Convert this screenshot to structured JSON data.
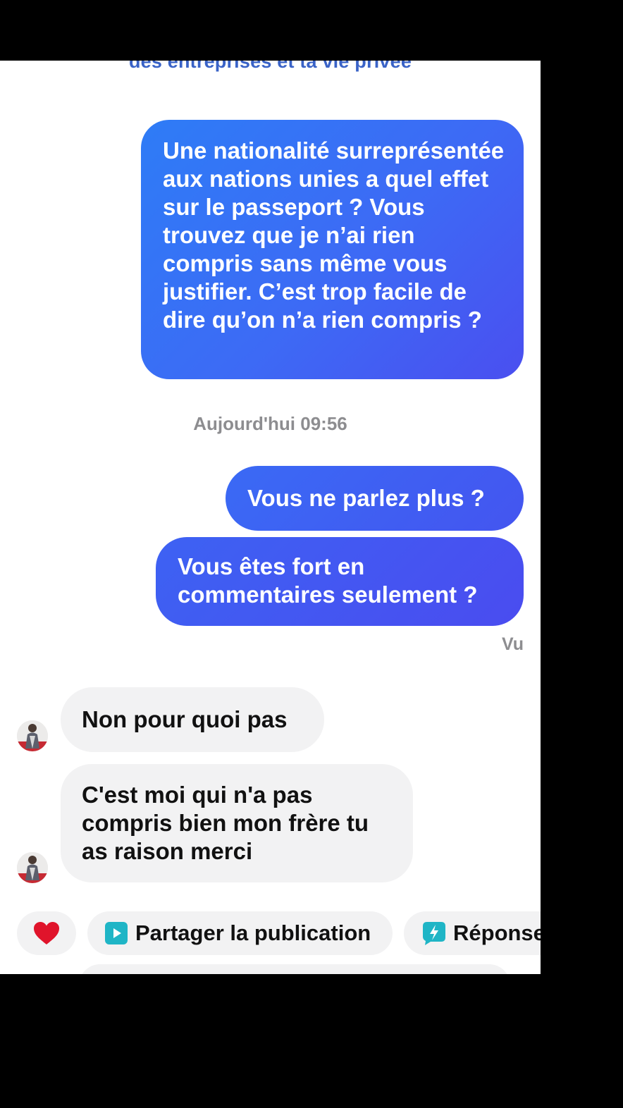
{
  "header": {
    "cut_text": "des entreprises et ta vie privée"
  },
  "conversation": {
    "outgoing": [
      "Une nationalité surreprésentée aux nations unies a quel effet sur le passeport ? Vous trouvez que je n’ai rien compris sans même vous justifier. C’est trop facile de dire qu’on n’a rien compris ?",
      "Vous ne parlez plus ?",
      "Vous êtes fort en commentaires seulement ?"
    ],
    "timestamp": "Aujourd'hui 09:56",
    "seen_status": "Vu",
    "incoming": [
      "Non pour quoi pas",
      "C'est moi qui n'a pas compris bien mon frère tu as raison merci"
    ]
  },
  "quick_actions": {
    "share_label": "Partager la publication",
    "reply_label": "Réponse",
    "heart_icon": "heart-icon",
    "share_icon": "play-square-icon",
    "reply_icon": "lightning-chat-icon"
  },
  "colors": {
    "outgoing_bubble": "#2e7cf6",
    "outgoing_bubble_end": "#4a4ff0",
    "incoming_bubble": "#f2f2f3",
    "accent_teal": "#1fb5c6",
    "heart": "#e0142b"
  }
}
